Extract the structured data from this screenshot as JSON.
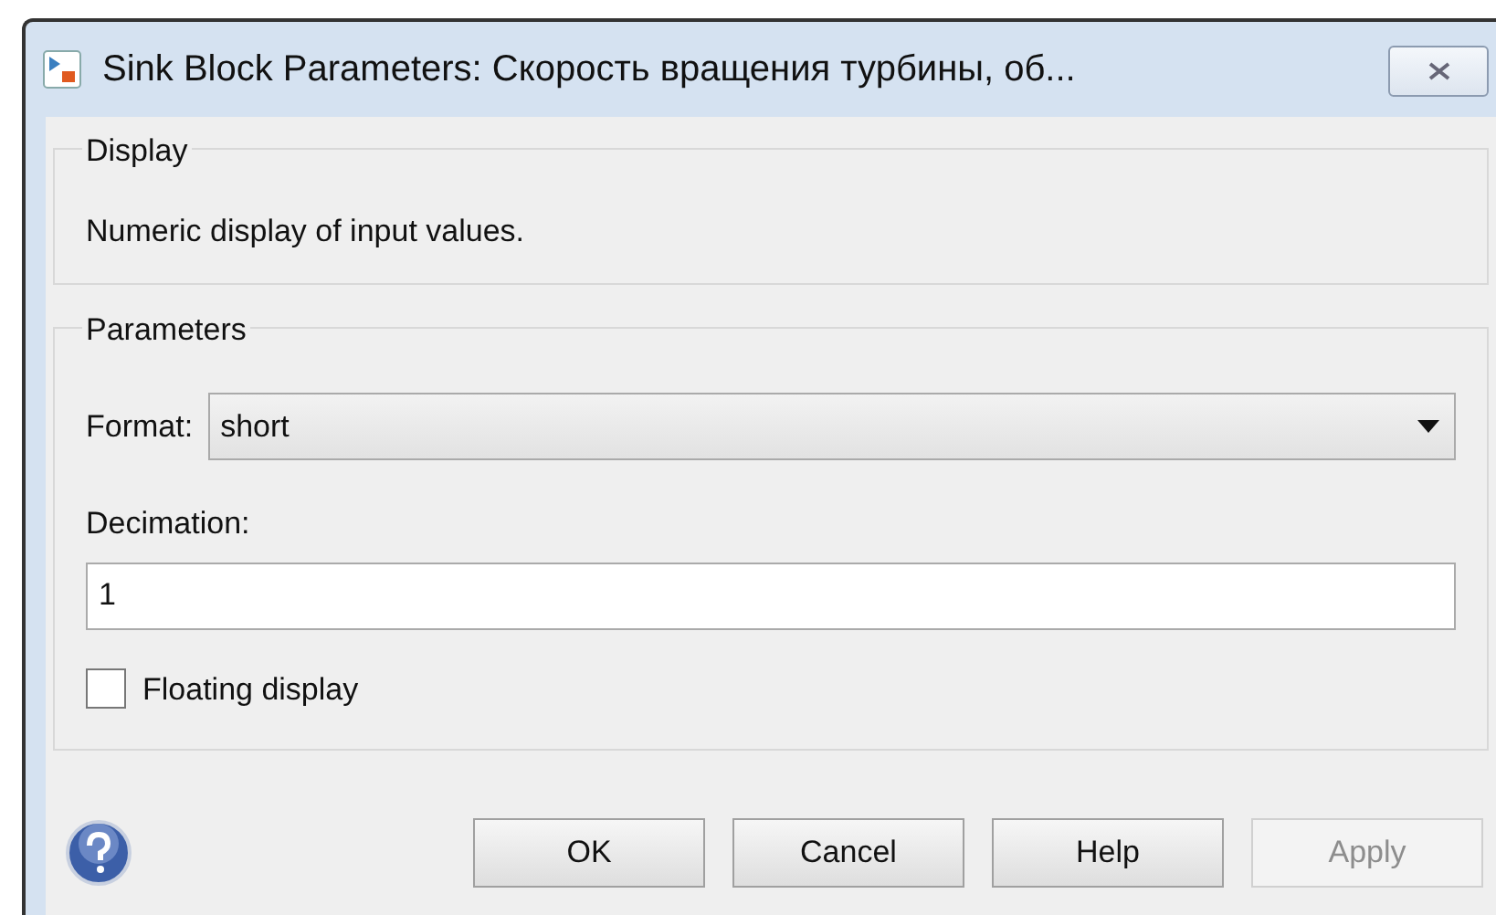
{
  "window": {
    "title": "Sink Block Parameters: Скорость вращения турбины, об..."
  },
  "display_group": {
    "title": "Display",
    "description": "Numeric display of input values."
  },
  "parameters_group": {
    "title": "Parameters",
    "format": {
      "label": "Format:",
      "value": "short"
    },
    "decimation": {
      "label": "Decimation:",
      "value": "1"
    },
    "floating_display": {
      "label": "Floating display",
      "checked": false
    }
  },
  "buttons": [
    {
      "label": "OK",
      "disabled": false
    },
    {
      "label": "Cancel",
      "disabled": false
    },
    {
      "label": "Help",
      "disabled": false
    },
    {
      "label": "Apply",
      "disabled": true
    }
  ]
}
